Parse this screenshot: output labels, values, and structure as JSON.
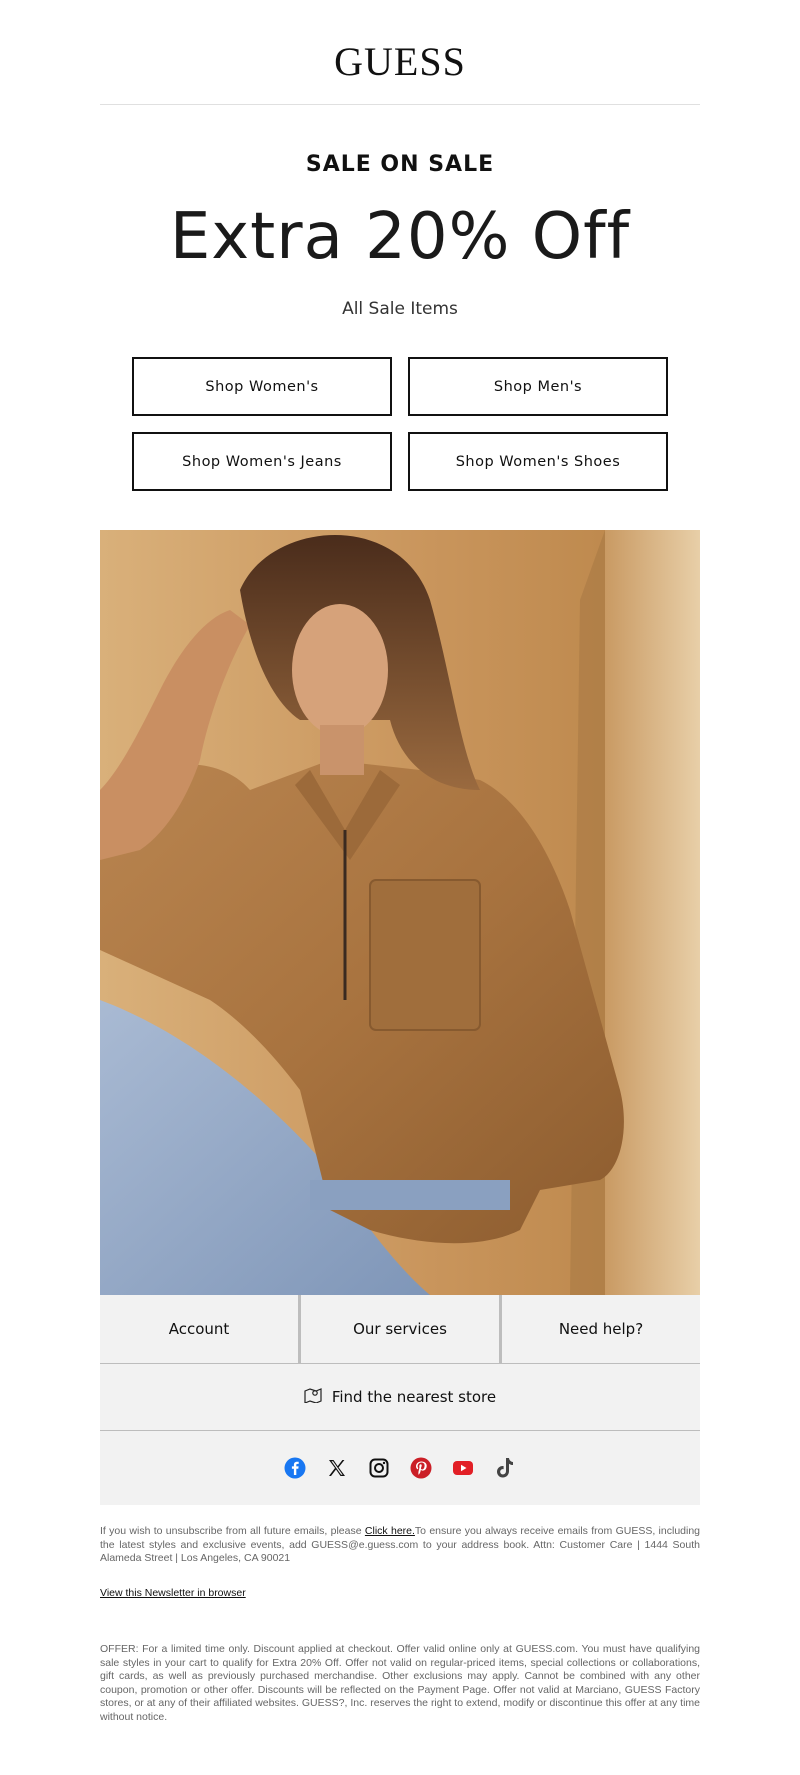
{
  "header": {
    "logo_text": "GUESS"
  },
  "promo": {
    "kicker": "SALE ON SALE",
    "headline": "Extra 20% Off",
    "subhead": "All Sale Items"
  },
  "buttons": [
    {
      "label": "Shop Women's"
    },
    {
      "label": "Shop Men's"
    },
    {
      "label": "Shop Women's Jeans"
    },
    {
      "label": "Shop Women's Shoes"
    }
  ],
  "hero": {
    "image_icon": "model-in-suede-jacket-photo"
  },
  "footer_links": [
    {
      "label": "Account"
    },
    {
      "label": "Our services"
    },
    {
      "label": "Need help?"
    }
  ],
  "store_locator": {
    "icon": "map-pin-icon",
    "label": "Find the nearest store"
  },
  "social": [
    {
      "icon": "facebook-icon",
      "color": "#1877F2"
    },
    {
      "icon": "x-icon",
      "color": "#111111"
    },
    {
      "icon": "instagram-icon",
      "color": "#111111"
    },
    {
      "icon": "pinterest-icon",
      "color": "#CB1F27"
    },
    {
      "icon": "youtube-icon",
      "color": "#E21F26"
    },
    {
      "icon": "tiktok-icon",
      "color": "#444444"
    }
  ],
  "legal": {
    "unsubscribe_pre": "If you wish to unsubscribe from all future emails, please ",
    "unsubscribe_link": "Click here.",
    "unsubscribe_post": "To ensure you always receive emails from GUESS, including the latest styles and exclusive events, add GUESS@e.guess.com to your address book. Attn: Customer Care | 1444 South Alameda Street | Los Angeles, CA 90021",
    "view_browser": "View this Newsletter in browser",
    "offer": "OFFER: For a limited time only. Discount applied at checkout. Offer valid online only at GUESS.com. You must have qualifying sale styles in your cart to qualify for Extra 20% Off. Offer not valid on regular-priced items, special collections or collaborations, gift cards, as well as previously purchased merchandise. Other exclusions may apply. Cannot be combined with any other coupon, promotion or other offer. Discounts will be reflected on the Payment Page. Offer not valid at Marciano, GUESS Factory stores, or at any of their affiliated websites. GUESS?, Inc. reserves the right to extend, modify or discontinue this offer at any time without notice."
  }
}
